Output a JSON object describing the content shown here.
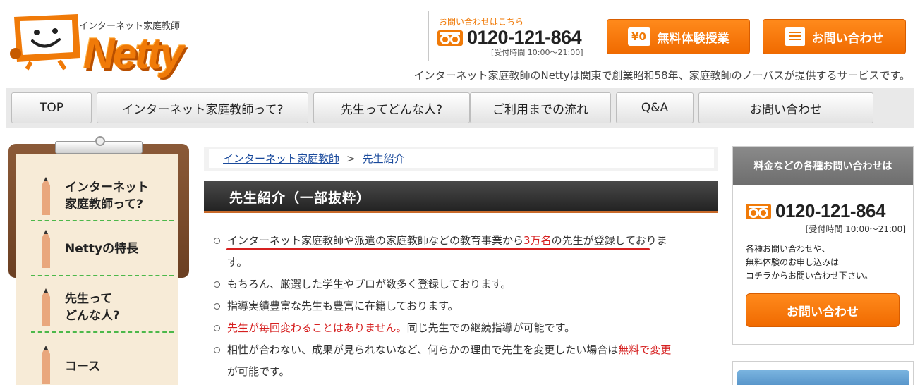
{
  "header": {
    "logo_tagline": "インターネット家庭教師",
    "logo_word": "Netty",
    "phone_lead": "お問い合わせはこちら",
    "phone_number": "0120-121-864",
    "phone_hours": "[受付時間 10:00〜21:00]",
    "trial_button": "無料体験授業",
    "trial_icon_text": "¥0",
    "contact_button": "お問い合わせ",
    "description": "インターネット家庭教師のNettyは関東で創業昭和58年、家庭教師のノーバスが提供するサービスです。"
  },
  "nav": {
    "items": [
      {
        "label": "TOP"
      },
      {
        "label": "インターネット家庭教師って?"
      },
      {
        "label": "先生ってどんな人?"
      },
      {
        "label": "ご利用までの流れ"
      },
      {
        "label": "Q&A"
      },
      {
        "label": "お問い合わせ"
      }
    ]
  },
  "sidebar": {
    "items": [
      {
        "line1": "インターネット",
        "line2": "家庭教師って?"
      },
      {
        "line1": "Nettyの特長",
        "line2": ""
      },
      {
        "line1": "先生って",
        "line2": "どんな人?"
      },
      {
        "line1": "コース",
        "line2": ""
      }
    ]
  },
  "main": {
    "breadcrumb": {
      "home": "インターネット家庭教師",
      "separator": ">",
      "current": "先生紹介"
    },
    "section_title": "先生紹介（一部抜粋）",
    "points": {
      "p1_a": "インターネット家庭教師や派遣の家庭教師などの教育事業から",
      "p1_red": "3万名",
      "p1_b": "の先生が登録しておりま",
      "p1_c": "す。",
      "p2": "もちろん、厳選した学生やプロが数多く登録しております。",
      "p3": "指導実績豊富な先生も豊富に在籍しております。",
      "p4_red": "先生が毎回変わることはありません。",
      "p4_b": "同じ先生での継続指導が可能です。",
      "p5_a": "相性が合わない、成果が見られないなど、何らかの理由で先生を変更したい場合は",
      "p5_red": "無料で変更",
      "p5_c": "が可能です。"
    }
  },
  "right": {
    "box_title": "料金などの各種お問い合わせは",
    "phone_number": "0120-121-864",
    "phone_hours": "[受付時間 10:00〜21:00]",
    "desc": "各種お問い合わせや、\n無料体験のお申し込みは\nコチラからお問い合わせ下さい。",
    "button": "お問い合わせ"
  },
  "colors": {
    "accent_orange": "#f07a08",
    "link_blue": "#1a4a9c",
    "highlight_red": "#d62020",
    "divider_green": "#4cb84a"
  },
  "icons": [
    "tv-mascot-icon",
    "free-dial-icon",
    "yen-icon",
    "document-icon",
    "pencil-icon"
  ]
}
